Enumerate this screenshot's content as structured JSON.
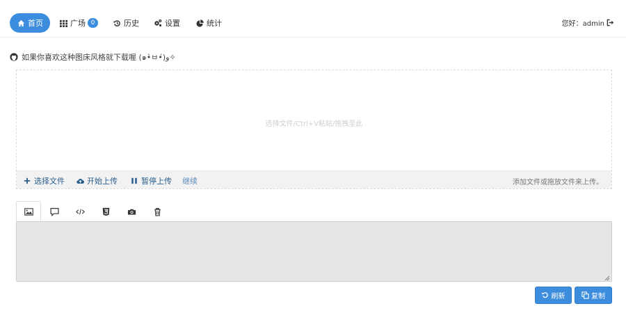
{
  "nav": {
    "items": [
      {
        "label": "首页",
        "icon": "home-icon"
      },
      {
        "label": "广场",
        "icon": "grid-icon",
        "badge": "0"
      },
      {
        "label": "历史",
        "icon": "history-icon"
      },
      {
        "label": "设置",
        "icon": "cogs-icon"
      },
      {
        "label": "统计",
        "icon": "pie-chart-icon"
      }
    ],
    "greeting": "您好：admin"
  },
  "tip": {
    "text": "如果你喜欢这种图床风格就下载喔 (๑•̀ㅂ•́)و✧"
  },
  "upload": {
    "drop_hint": "选择文件/Ctrl+V粘贴/拖拽至此",
    "select_label": "选择文件",
    "start_label": "开始上传",
    "pause_label": "暂停上传",
    "retry_label": "继续",
    "status_hint": "添加文件或拖放文件来上传。"
  },
  "tabs": [
    "image-icon",
    "comment-icon",
    "code-icon",
    "html5-icon",
    "camera-icon",
    "trash-icon"
  ],
  "output": {
    "value": ""
  },
  "buttons": {
    "refresh_label": "刷新",
    "copy_label": "复制"
  },
  "colors": {
    "accent": "#3c8dde",
    "link": "#285e8e"
  }
}
